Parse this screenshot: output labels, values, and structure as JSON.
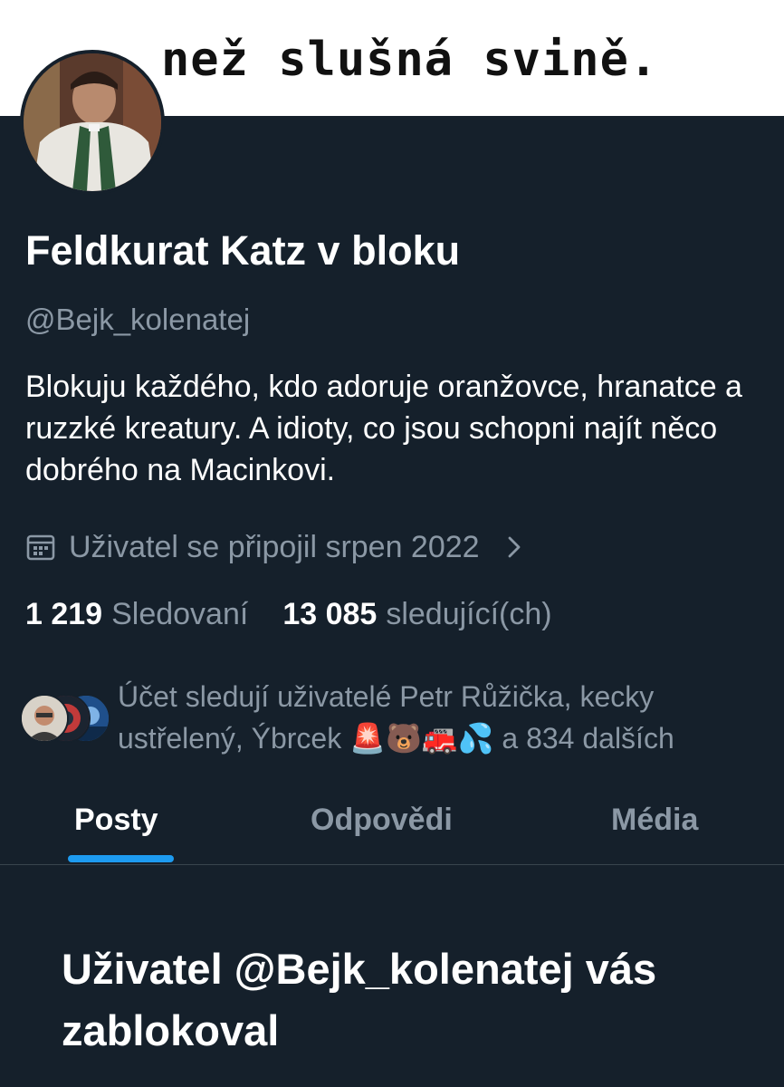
{
  "banner": {
    "text": "než slušná svině."
  },
  "profile": {
    "display_name": "Feldkurat Katz v bloku",
    "handle": "@Bejk_kolenatej",
    "bio": "Blokuju každého, kdo adoruje oranžovce, hranatce a ruzzké kreatury. A idioty, co jsou schopni najít něco dobrého na Macinkovi.",
    "joined": "Uživatel se připojil srpen 2022",
    "joined_icon": "calendar-icon",
    "joined_chevron_icon": "chevron-right-icon"
  },
  "stats": {
    "following_count": "1 219",
    "following_label": "Sledovaní",
    "followers_count": "13 085",
    "followers_label": "sledující(ch)"
  },
  "followed_by": {
    "text": "Účet sledují uživatelé Petr Růžička, kecky ustřelený, Ýbrcek 🚨🐻🚒💦 a 834 dalších"
  },
  "tabs": [
    {
      "label": "Posty",
      "active": true
    },
    {
      "label": "Odpovědi",
      "active": false
    },
    {
      "label": "Média",
      "active": false
    }
  ],
  "blocked_message": "Uživatel @Bejk_kolenatej vás zablokoval",
  "colors": {
    "background": "#15202b",
    "secondary_text": "#8b98a5",
    "accent": "#1d9bf0",
    "divider": "#38444d"
  }
}
